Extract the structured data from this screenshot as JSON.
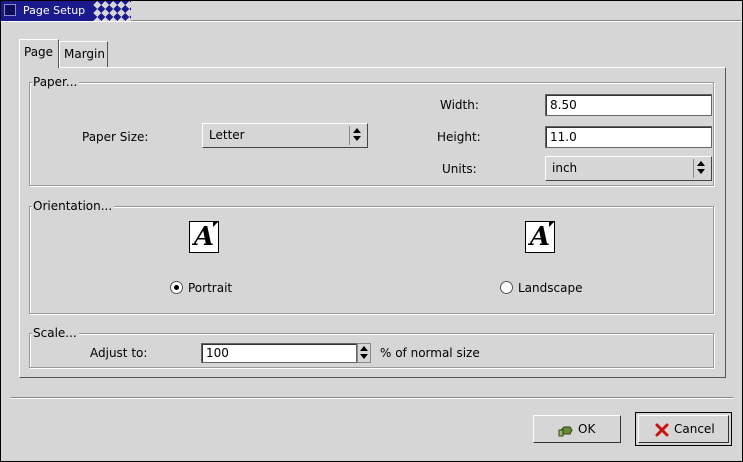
{
  "window": {
    "title": "Page Setup"
  },
  "tabs": [
    {
      "label": "Page"
    },
    {
      "label": "Margin"
    }
  ],
  "paper": {
    "section_label": "Paper...",
    "size_label": "Paper Size:",
    "size_value": "Letter",
    "width_label": "Width:",
    "width_value": "8.50",
    "height_label": "Height:",
    "height_value": "11.0",
    "units_label": "Units:",
    "units_value": "inch"
  },
  "orientation": {
    "section_label": "Orientation...",
    "icon_glyph": "A",
    "portrait_label": "Portrait",
    "landscape_label": "Landscape",
    "selected": "portrait"
  },
  "scale": {
    "section_label": "Scale...",
    "adjust_label": "Adjust to:",
    "value": "100",
    "suffix": "% of normal size"
  },
  "buttons": {
    "ok_label": "OK",
    "cancel_label": "Cancel"
  },
  "colors": {
    "title_bar": "#1a1a8c",
    "window_bg": "#d6d6d6",
    "cancel_icon": "#cc1111",
    "ok_icon": "#6a8a3a"
  }
}
